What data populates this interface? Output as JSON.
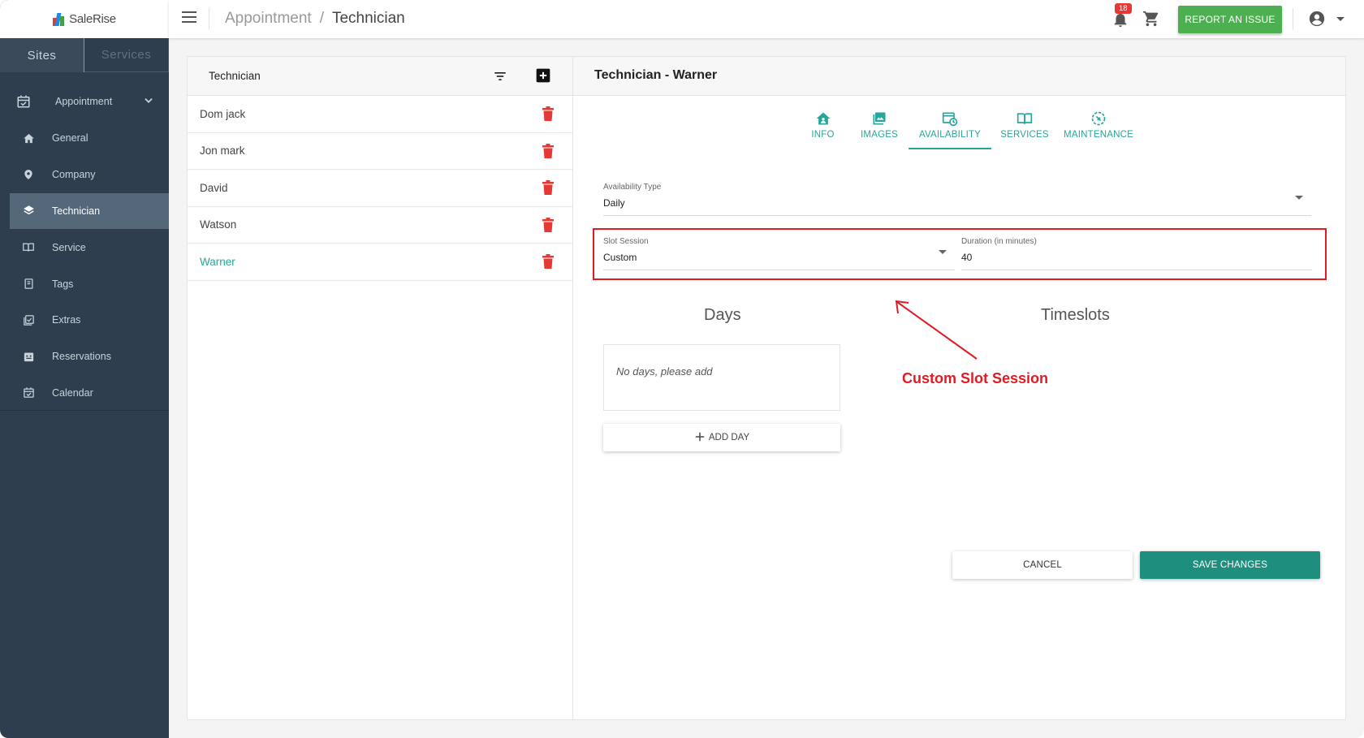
{
  "app": {
    "logo_text": "SaleRise"
  },
  "sidebar": {
    "tabs": [
      {
        "label": "Sites",
        "active": true
      },
      {
        "label": "Services",
        "active": false
      }
    ],
    "parent": {
      "label": "Appointment",
      "icon": "calendar-check-icon"
    },
    "items": [
      {
        "label": "General",
        "icon": "home-icon"
      },
      {
        "label": "Company",
        "icon": "location-pin-icon"
      },
      {
        "label": "Technician",
        "icon": "layers-icon",
        "active": true
      },
      {
        "label": "Service",
        "icon": "book-icon"
      },
      {
        "label": "Tags",
        "icon": "tag-icon"
      },
      {
        "label": "Extras",
        "icon": "extras-icon"
      },
      {
        "label": "Reservations",
        "icon": "reservations-icon"
      },
      {
        "label": "Calendar",
        "icon": "calendar-icon"
      }
    ]
  },
  "topbar": {
    "breadcrumb": [
      "Appointment",
      "/",
      "Technician"
    ],
    "notification_count": "18",
    "report_button": "REPORT AN ISSUE"
  },
  "list": {
    "title": "Technician",
    "rows": [
      {
        "name": "Dom jack"
      },
      {
        "name": "Jon mark"
      },
      {
        "name": "David"
      },
      {
        "name": "Watson"
      },
      {
        "name": "Warner",
        "selected": true
      }
    ]
  },
  "detail": {
    "title": "Technician - Warner",
    "tabs": [
      {
        "label": "INFO",
        "icon": "home-icon"
      },
      {
        "label": "IMAGES",
        "icon": "images-icon"
      },
      {
        "label": "AVAILABILITY",
        "icon": "availability-icon",
        "active": true
      },
      {
        "label": "SERVICES",
        "icon": "book-icon"
      },
      {
        "label": "MAINTENANCE",
        "icon": "maintenance-icon"
      }
    ],
    "availability_type": {
      "label": "Availability Type",
      "value": "Daily"
    },
    "slot_session": {
      "label": "Slot Session",
      "value": "Custom"
    },
    "duration": {
      "label": "Duration (in minutes)",
      "value": "40"
    },
    "days_title": "Days",
    "timeslots_title": "Timeslots",
    "days_empty": "No days, please add",
    "add_day": "ADD DAY",
    "annotation": "Custom Slot Session",
    "cancel": "CANCEL",
    "save": "SAVE CHANGES"
  },
  "colors": {
    "accent": "#26a69a",
    "sidebar_bg": "#2f3e4e",
    "report_green": "#4caf50",
    "delete_red": "#e53935",
    "annotation_red": "#e01b24"
  }
}
